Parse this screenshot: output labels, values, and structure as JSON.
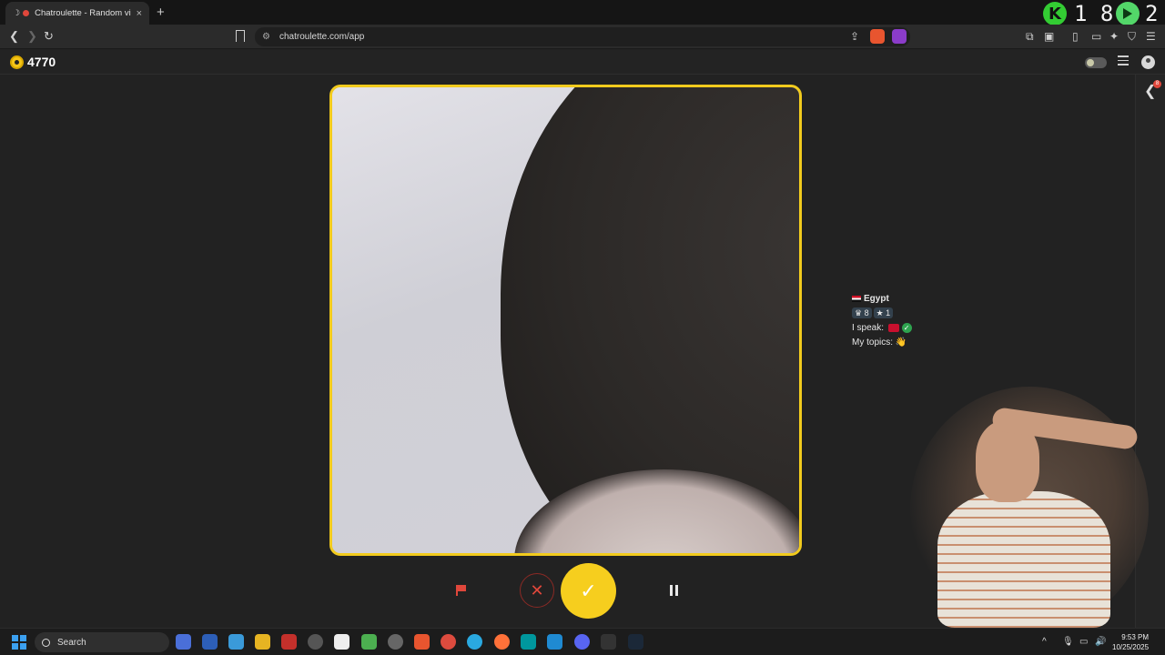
{
  "browser": {
    "tab_title": "Chatroulette - Random video",
    "tab_close": "×",
    "new_tab": "+",
    "url": "chatroulette.com/app"
  },
  "overlay": {
    "kick_count": "1 8",
    "play_count": "2"
  },
  "site": {
    "coins": "4770",
    "rail_badge": "8"
  },
  "partner": {
    "country": "Egypt",
    "stat_a": "8",
    "stat_b": "1",
    "speak_label": "I speak:",
    "topics_label": "My topics:",
    "topics_emoji": "👋"
  },
  "controls": {
    "skip_glyph": "✕",
    "accept_glyph": "✓"
  },
  "taskbar": {
    "search_placeholder": "Search",
    "time": "9:53 PM",
    "date": "10/25/2025"
  }
}
